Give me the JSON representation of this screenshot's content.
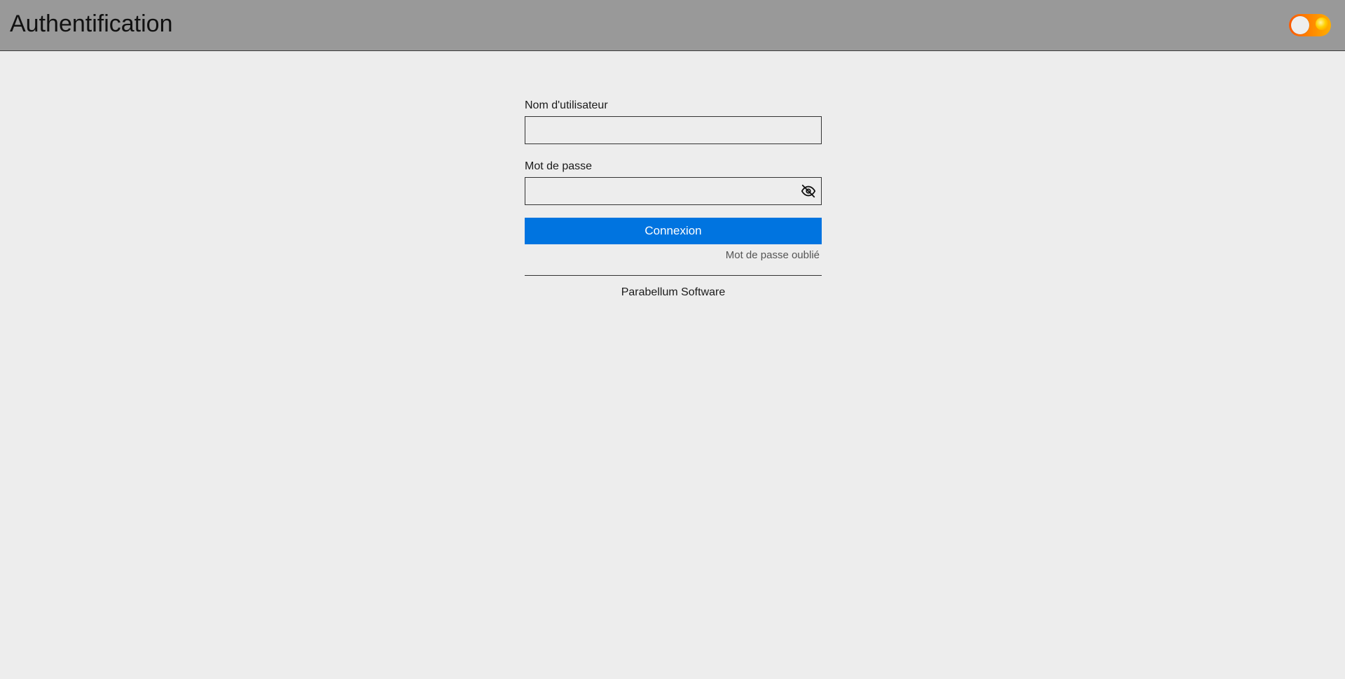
{
  "header": {
    "title": "Authentification",
    "theme_toggle": {
      "state": "off",
      "colors": {
        "track_start": "#ff5a00",
        "track_end": "#ffb000",
        "knob": "#eeeeee"
      }
    }
  },
  "form": {
    "username": {
      "label": "Nom d'utilisateur",
      "value": "",
      "placeholder": ""
    },
    "password": {
      "label": "Mot de passe",
      "value": "",
      "placeholder": "",
      "visibility_icon": "eye-slash-icon"
    },
    "submit_label": "Connexion",
    "forgot_label": "Mot de passe oublié"
  },
  "footer": {
    "brand": "Parabellum Software"
  },
  "colors": {
    "header_bg": "#999999",
    "page_bg": "#ededed",
    "primary": "#0074e0"
  }
}
